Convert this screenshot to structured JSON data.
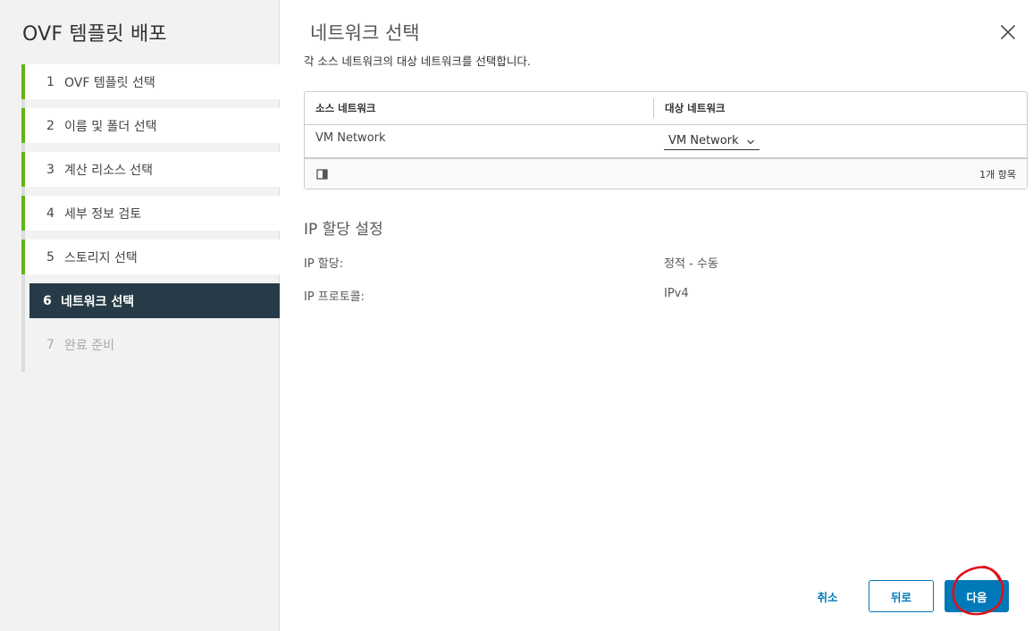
{
  "wizard": {
    "title": "OVF 템플릿 배포",
    "steps": [
      {
        "num": "1",
        "label": "OVF 템플릿 선택",
        "state": "done"
      },
      {
        "num": "2",
        "label": "이름 및 폴더 선택",
        "state": "done"
      },
      {
        "num": "3",
        "label": "계산 리소스 선택",
        "state": "done"
      },
      {
        "num": "4",
        "label": "세부 정보 검토",
        "state": "done"
      },
      {
        "num": "5",
        "label": "스토리지 선택",
        "state": "done"
      },
      {
        "num": "6",
        "label": "네트워크 선택",
        "state": "active"
      },
      {
        "num": "7",
        "label": "완료 준비",
        "state": "disabled"
      }
    ]
  },
  "main": {
    "title": "네트워크 선택",
    "subtitle": "각 소스 네트워크의 대상 네트워크를 선택합니다.",
    "close_icon": "close-icon"
  },
  "grid": {
    "columns": [
      "소스 네트워크",
      "대상 네트워크"
    ],
    "rows": [
      {
        "source": "VM Network",
        "destination": "VM Network"
      }
    ],
    "footer_count": "1개 항목"
  },
  "ip": {
    "section_title": "IP 할당 설정",
    "allocation_label": "IP 할당:",
    "allocation_value": "정적 - 수동",
    "protocol_label": "IP 프로토콜:",
    "protocol_value": "IPv4"
  },
  "buttons": {
    "cancel": "취소",
    "back": "뒤로",
    "next": "다음"
  },
  "colors": {
    "accent": "#0079b8",
    "step_done": "#60b515",
    "step_active_bg": "#263b47",
    "annotation_red": "#e0101a"
  }
}
